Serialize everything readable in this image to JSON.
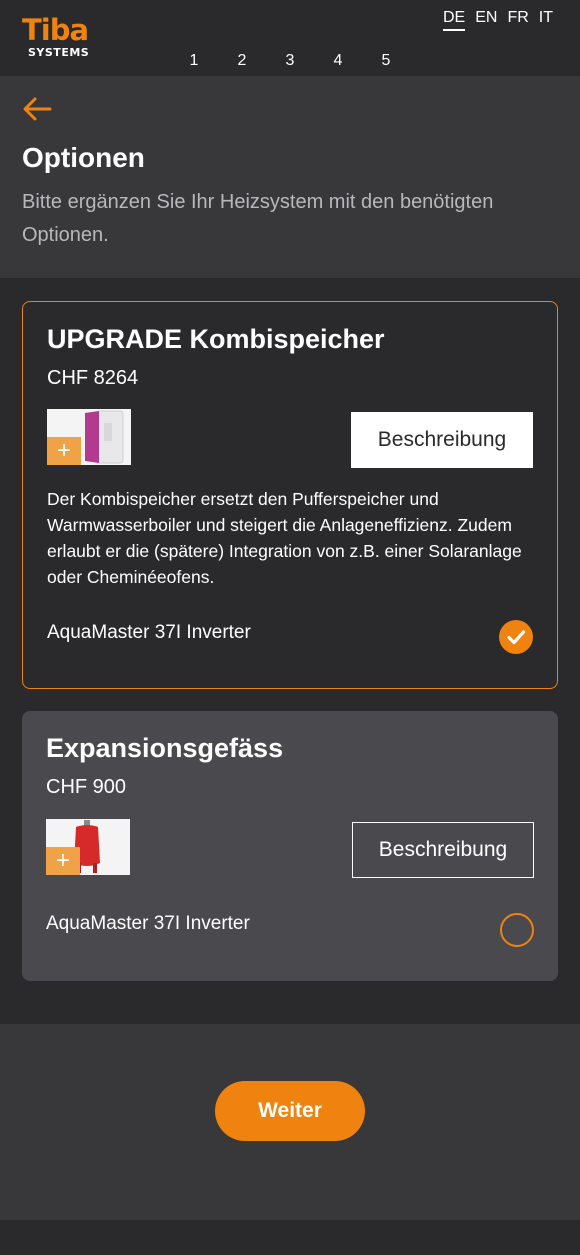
{
  "brand": {
    "name": "Tiba",
    "sub": "SYSTEMS"
  },
  "languages": [
    {
      "code": "DE",
      "active": true
    },
    {
      "code": "EN",
      "active": false
    },
    {
      "code": "FR",
      "active": false
    },
    {
      "code": "IT",
      "active": false
    }
  ],
  "steps": [
    "1",
    "2",
    "3",
    "4",
    "5"
  ],
  "page": {
    "title": "Optionen",
    "subtitle": "Bitte ergänzen Sie Ihr Heizsystem mit den benötigten Optionen."
  },
  "options": [
    {
      "title": "UPGRADE Kombispeicher",
      "price": "CHF 8264",
      "button": "Beschreibung",
      "description": "Der Kombispeicher ersetzt den Pufferspeicher und Warmwasserboiler und steigert die Anlageneffizienz. Zudem erlaubt er die (spätere) Integration von z.B. einer Solaranlage oder Cheminéeofens.",
      "product": "AquaMaster 37I Inverter",
      "selected": true
    },
    {
      "title": "Expansionsgefäss",
      "price": "CHF 900",
      "button": "Beschreibung",
      "product": "AquaMaster 37I Inverter",
      "selected": false
    }
  ],
  "footer": {
    "next_label": "Weiter"
  },
  "colors": {
    "accent": "#f0820f",
    "background": "#2a2a2d",
    "panel": "#38383b",
    "card_unselected": "#4a4a4e"
  }
}
